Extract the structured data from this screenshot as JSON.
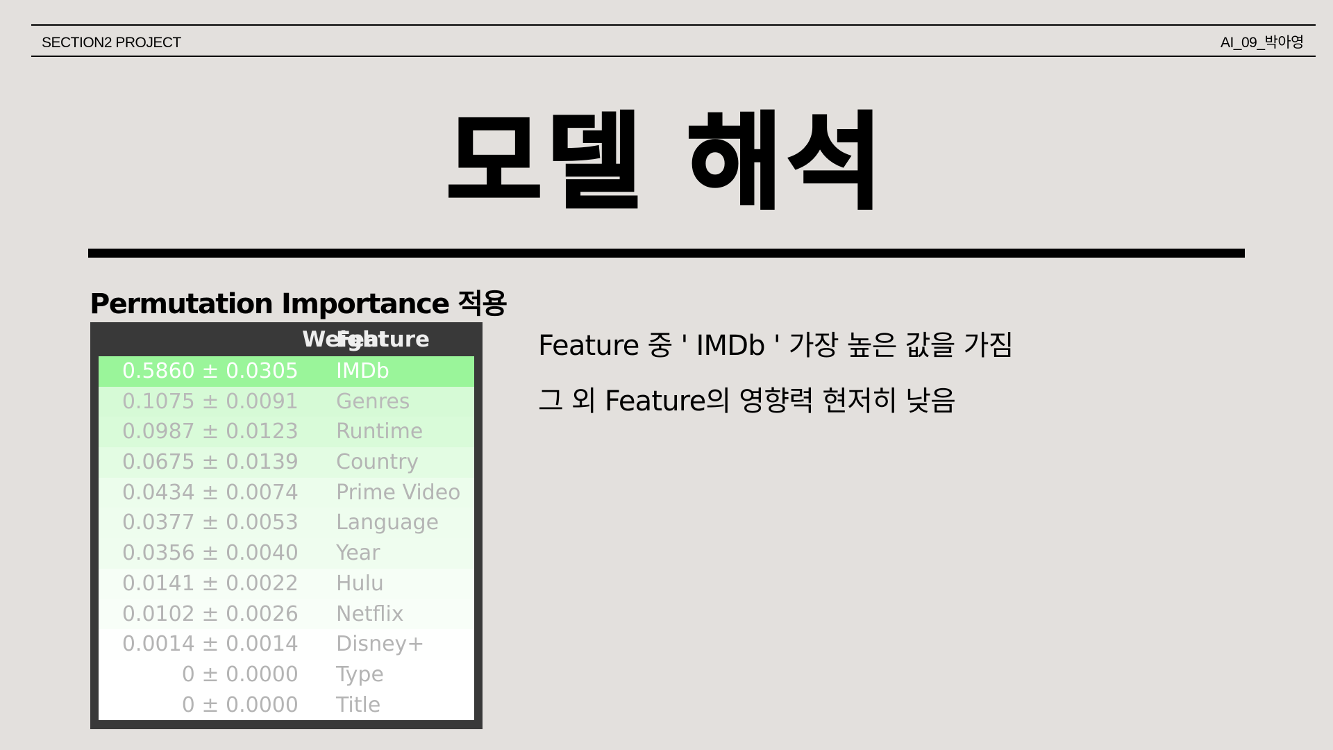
{
  "header": {
    "left": "SECTION2 PROJECT",
    "right": "AI_09_박아영"
  },
  "title": "모델 해석",
  "section_heading": "Permutation Importance 적용",
  "table": {
    "headers": {
      "weight": "Weight",
      "feature": "Feature"
    },
    "rows": [
      {
        "weight": "0.5860 ± 0.0305",
        "feature": "IMDb",
        "bg": "#9af59a",
        "text": "#ffffff"
      },
      {
        "weight": "0.1075 ± 0.0091",
        "feature": "Genres",
        "bg": "#d6fad6",
        "text": "#b9b9b9"
      },
      {
        "weight": "0.0987 ± 0.0123",
        "feature": "Runtime",
        "bg": "#d9fbd9",
        "text": "#b6b6b6"
      },
      {
        "weight": "0.0675 ± 0.0139",
        "feature": "Country",
        "bg": "#e3fce3",
        "text": "#b4b4b4"
      },
      {
        "weight": "0.0434 ± 0.0074",
        "feature": "Prime Video",
        "bg": "#ecfdec",
        "text": "#b4b4b4"
      },
      {
        "weight": "0.0377 ± 0.0053",
        "feature": "Language",
        "bg": "#eefdee",
        "text": "#b4b4b4"
      },
      {
        "weight": "0.0356 ± 0.0040",
        "feature": "Year",
        "bg": "#effdef",
        "text": "#b4b4b4"
      },
      {
        "weight": "0.0141 ± 0.0022",
        "feature": "Hulu",
        "bg": "#f6fef6",
        "text": "#b4b4b4"
      },
      {
        "weight": "0.0102 ± 0.0026",
        "feature": "Netflix",
        "bg": "#f8fef8",
        "text": "#b4b4b4"
      },
      {
        "weight": "0.0014 ± 0.0014",
        "feature": "Disney+",
        "bg": "#fefffe",
        "text": "#b4b4b4"
      },
      {
        "weight": "0 ± 0.0000",
        "feature": "Type",
        "bg": "#ffffff",
        "text": "#b4b4b4"
      },
      {
        "weight": "0 ± 0.0000",
        "feature": "Title",
        "bg": "#ffffff",
        "text": "#b4b4b4"
      }
    ]
  },
  "description": {
    "line1": "Feature 중 ' IMDb '  가장 높은 값을 가짐",
    "line2": "그 외 Feature의 영향력 현저히 낮음"
  },
  "colors": {
    "background": "#e3e0dd",
    "table_frame": "#393939",
    "highlight_green": "#9af59a"
  }
}
